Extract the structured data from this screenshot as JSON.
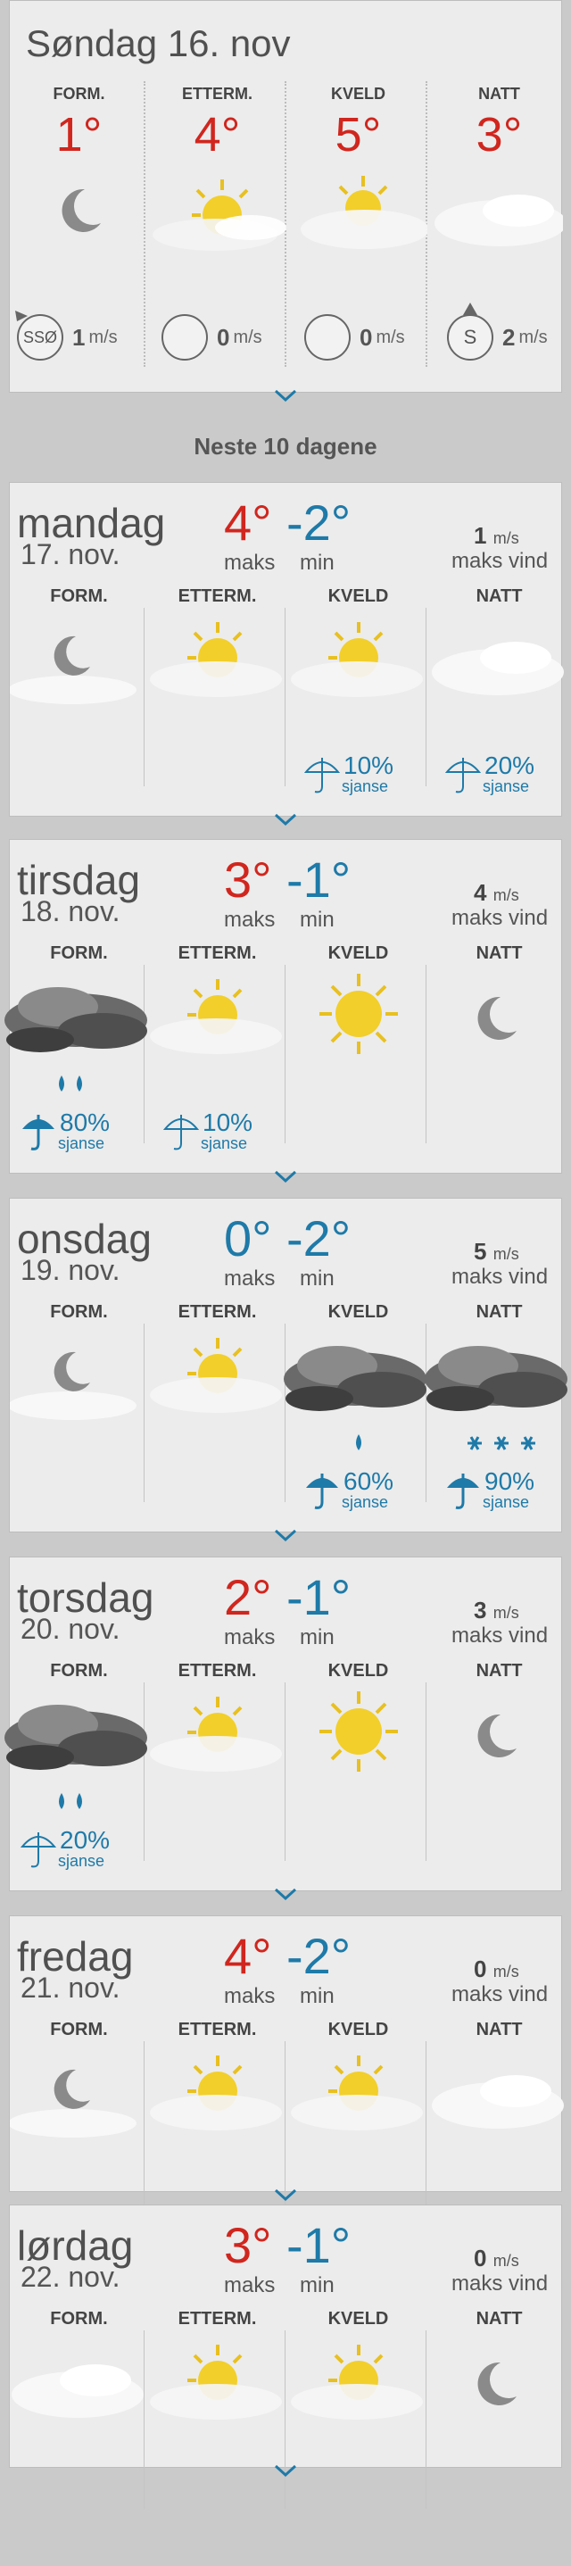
{
  "today": {
    "title": "Søndag 16. nov",
    "periods": [
      {
        "label": "FORM.",
        "temp": "1°",
        "icon": "moon-icon",
        "wind_dir": "SSØ",
        "wind_value": "1",
        "wind_unit": "m/s"
      },
      {
        "label": "ETTERM.",
        "temp": "4°",
        "icon": "sun-cloud-icon",
        "wind_dir": "",
        "wind_value": "0",
        "wind_unit": "m/s"
      },
      {
        "label": "KVELD",
        "temp": "5°",
        "icon": "sun-cloud-icon",
        "wind_dir": "",
        "wind_value": "0",
        "wind_unit": "m/s"
      },
      {
        "label": "NATT",
        "temp": "3°",
        "icon": "cloud-icon",
        "wind_dir": "S",
        "wind_value": "2",
        "wind_unit": "m/s"
      }
    ]
  },
  "section_title": "Neste 10 dagene",
  "labels": {
    "maks": "maks",
    "min": "min",
    "maks_vind": "maks vind",
    "unit": "m/s",
    "sjanse": "sjanse",
    "form": "FORM.",
    "etterm": "ETTERM.",
    "kveld": "KVELD",
    "natt": "NATT"
  },
  "days": [
    {
      "name": "mandag",
      "date": "17. nov.",
      "max": "4°",
      "min": "-2°",
      "wind": "1",
      "rain": [
        {
          "pct": "10%",
          "col": 2
        },
        {
          "pct": "20%",
          "col": 3
        }
      ]
    },
    {
      "name": "tirsdag",
      "date": "18. nov.",
      "max": "3°",
      "min": "-1°",
      "wind": "4",
      "rain": [
        {
          "pct": "80%",
          "col": 0
        },
        {
          "pct": "10%",
          "col": 1
        }
      ]
    },
    {
      "name": "onsdag",
      "date": "19. nov.",
      "max": "0°",
      "min": "-2°",
      "wind": "5",
      "rain": [
        {
          "pct": "60%",
          "col": 2
        },
        {
          "pct": "90%",
          "col": 3
        }
      ]
    },
    {
      "name": "torsdag",
      "date": "20. nov.",
      "max": "2°",
      "min": "-1°",
      "wind": "3",
      "rain": [
        {
          "pct": "20%",
          "col": 0
        }
      ]
    },
    {
      "name": "fredag",
      "date": "21. nov.",
      "max": "4°",
      "min": "-2°",
      "wind": "0",
      "rain": []
    },
    {
      "name": "lørdag",
      "date": "22. nov.",
      "max": "3°",
      "min": "-1°",
      "wind": "0",
      "rain": []
    }
  ],
  "colors": {
    "max_temp": "#d0261e",
    "min_temp": "#1e7aa8",
    "card": "#ececec",
    "background": "#cacaca"
  }
}
